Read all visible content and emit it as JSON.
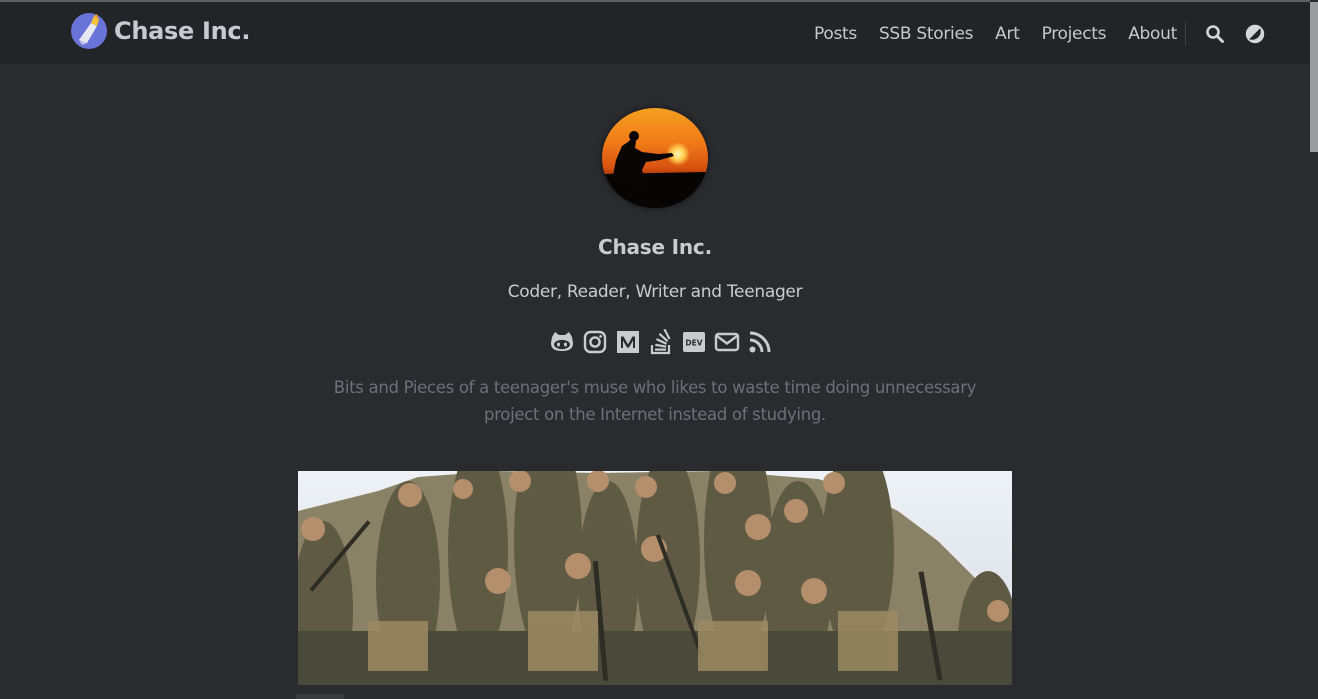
{
  "site": {
    "brand_name": "Chase Inc."
  },
  "nav": {
    "items": [
      {
        "label": "Posts"
      },
      {
        "label": "SSB Stories"
      },
      {
        "label": "Art"
      },
      {
        "label": "Projects"
      },
      {
        "label": "About"
      }
    ],
    "search_icon": "search-icon",
    "theme_icon": "theme-toggle-icon"
  },
  "profile": {
    "name": "Chase Inc.",
    "subtitle": "Coder, Reader, Writer and Teenager",
    "description": "Bits and Pieces of a teenager's muse who likes to waste time doing unnecessary project on the Internet instead of studying.",
    "social": [
      "github-icon",
      "instagram-icon",
      "medium-icon",
      "stackoverflow-icon",
      "dev-icon",
      "email-icon",
      "rss-icon"
    ]
  },
  "colors": {
    "background": "#2a2b2f",
    "header": "#232427",
    "text": "#c9cbcf",
    "muted": "#6e7075"
  }
}
